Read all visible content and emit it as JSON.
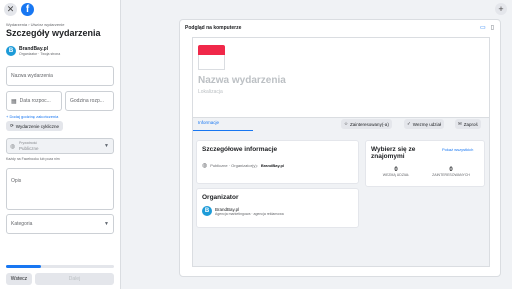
{
  "left": {
    "breadcrumb": "Wydarzenia › Utwórz wydarzenie",
    "title": "Szczegóły wydarzenia",
    "host": {
      "initial": "B",
      "name": "BrandBay.pl",
      "sub": "Organizator · Twoja strona"
    },
    "event_name_placeholder": "Nazwa wydarzenia",
    "date_placeholder": "Data rozpoc...",
    "time_placeholder": "Godzina rozp...",
    "end_time_link": "+ Dodaj godzinę zakończenia",
    "recurring_button": "Wydarzenie cykliczne",
    "privacy_label": "Prywatność",
    "privacy_value": "Publiczne",
    "privacy_hint": "Każdy na Facebooku lub poza nim",
    "description_placeholder": "Opis",
    "category_placeholder": "Kategoria",
    "progress": 0.32,
    "back_button": "Wstecz",
    "next_button": "Dalej"
  },
  "preview": {
    "header": "Podgląd na komputerze",
    "event_name": "Nazwa wydarzenia",
    "location": "Lokalizacja",
    "tab": "Informacje",
    "actions": [
      "Zainteresowany(-a)",
      "Wezmę udział",
      "Zaproś"
    ],
    "details": {
      "title": "Szczegółowe informacje",
      "line": "Publiczne · Organizator(y): ",
      "organizer_link": "BrandBay.pl"
    },
    "organizer": {
      "title": "Organizator",
      "name": "BrandBay.pl",
      "sub": "Agencja marketingowa · agencja reklamowa"
    },
    "friends": {
      "title": "Wybierz się ze znajomymi",
      "show_all": "Pokaż wszystkich",
      "stats": [
        {
          "count": "0",
          "label": "WEZMĄ UDZIAŁ"
        },
        {
          "count": "0",
          "label": "ZAINTERESOWANYCH"
        }
      ]
    }
  }
}
